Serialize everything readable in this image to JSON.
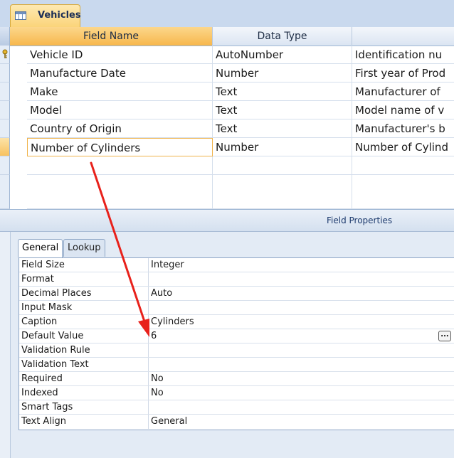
{
  "tab": {
    "label": "Vehicles",
    "icon": "table-icon"
  },
  "grid": {
    "columns": [
      "Field Name",
      "Data Type",
      ""
    ],
    "rows": [
      {
        "field": "Vehicle ID",
        "type": "AutoNumber",
        "desc": "Identification nu",
        "primary_key": true
      },
      {
        "field": "Manufacture Date",
        "type": "Number",
        "desc": "First year of Prod"
      },
      {
        "field": "Make",
        "type": "Text",
        "desc": "Manufacturer of"
      },
      {
        "field": "Model",
        "type": "Text",
        "desc": "Model name of v"
      },
      {
        "field": "Country of Origin",
        "type": "Text",
        "desc": "Manufacturer's b"
      },
      {
        "field": "Number of Cylinders",
        "type": "Number",
        "desc": "Number of Cylind",
        "current": true
      }
    ]
  },
  "field_properties": {
    "title": "Field Properties",
    "tabs": [
      "General",
      "Lookup"
    ],
    "active_tab": "General",
    "properties": [
      {
        "name": "Field Size",
        "value": "Integer"
      },
      {
        "name": "Format",
        "value": ""
      },
      {
        "name": "Decimal Places",
        "value": "Auto"
      },
      {
        "name": "Input Mask",
        "value": ""
      },
      {
        "name": "Caption",
        "value": "Cylinders"
      },
      {
        "name": "Default Value",
        "value": "6",
        "builder": "..."
      },
      {
        "name": "Validation Rule",
        "value": ""
      },
      {
        "name": "Validation Text",
        "value": ""
      },
      {
        "name": "Required",
        "value": "No"
      },
      {
        "name": "Indexed",
        "value": "No"
      },
      {
        "name": "Smart Tags",
        "value": ""
      },
      {
        "name": "Text Align",
        "value": "General"
      }
    ]
  },
  "colors": {
    "tab_bar": "#c9d9ee",
    "active_accent": "#f7b74c",
    "annotation_arrow": "#e8211b"
  }
}
